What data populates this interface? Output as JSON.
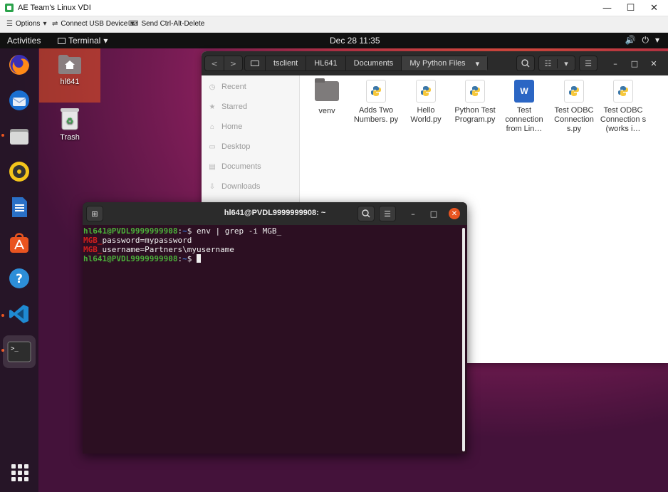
{
  "vdi": {
    "title": "AE Team's Linux VDI",
    "toolbar": {
      "options": "Options",
      "connect_usb": "Connect USB Device",
      "send_cad": "Send Ctrl-Alt-Delete"
    }
  },
  "topbar": {
    "activities": "Activities",
    "app_menu": "Terminal",
    "clock": "Dec 28  11:35"
  },
  "desktop": {
    "icons": [
      {
        "label": "hl641",
        "icon": "home-folder-icon"
      },
      {
        "label": "Trash",
        "icon": "trash-icon"
      }
    ]
  },
  "dock": {
    "apps": [
      "firefox",
      "thunderbird",
      "files",
      "rhythmbox",
      "libreoffice-writer",
      "ubuntu-software",
      "help",
      "vs-code",
      "terminal"
    ]
  },
  "files": {
    "breadcrumbs": [
      "tsclient",
      "HL641",
      "Documents",
      "My Python Files"
    ],
    "sidebar": [
      "Recent",
      "Starred",
      "Home",
      "Desktop",
      "Documents",
      "Downloads"
    ],
    "items": [
      {
        "name": "venv",
        "type": "folder"
      },
      {
        "name": "Adds Two Numbers. py",
        "type": "python"
      },
      {
        "name": "Hello World.py",
        "type": "python"
      },
      {
        "name": "Python Test Program.py",
        "type": "python"
      },
      {
        "name": "Test connection from Lin…",
        "type": "word"
      },
      {
        "name": "Test ODBC Connection s.py",
        "type": "python"
      },
      {
        "name": "Test ODBC Connection s (works i…",
        "type": "python"
      }
    ]
  },
  "terminal": {
    "title": "hl641@PVDL9999999908: ~",
    "prompt_user": "hl641@PVDL9999999908",
    "prompt_path": "~",
    "command": "env | grep -i MGB_",
    "match": "MGB_",
    "line1_rest": "password=mypassword",
    "line2_rest": "username=Partners\\myusername",
    "accent": "#e95420"
  }
}
